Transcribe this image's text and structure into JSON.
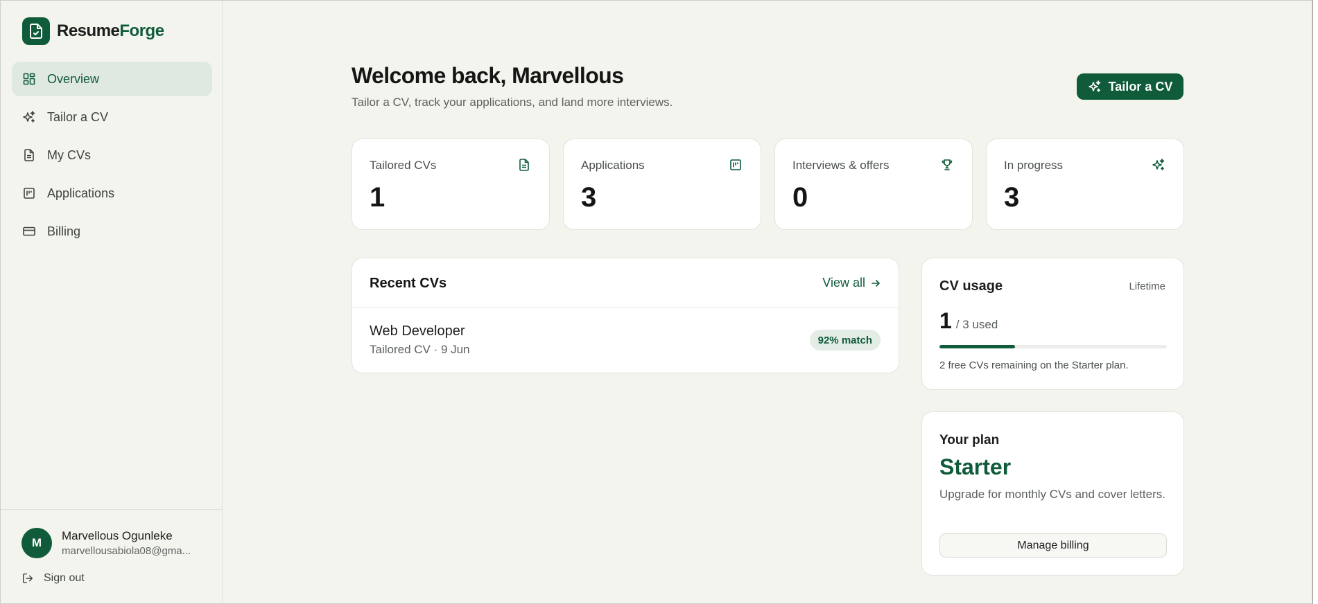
{
  "brand": {
    "part1": "Resume",
    "part2": "Forge",
    "logo_icon": "document-check-icon"
  },
  "colors": {
    "accent": "#0f5b3a",
    "active_bg": "#dfe8e1",
    "page_bg": "#f4f4ef",
    "card_bg": "#ffffff"
  },
  "sidebar": {
    "items": [
      {
        "label": "Overview",
        "icon": "dashboard-icon",
        "active": true
      },
      {
        "label": "Tailor a CV",
        "icon": "sparkles-icon",
        "active": false
      },
      {
        "label": "My CVs",
        "icon": "document-icon",
        "active": false
      },
      {
        "label": "Applications",
        "icon": "kanban-icon",
        "active": false
      },
      {
        "label": "Billing",
        "icon": "credit-card-icon",
        "active": false
      }
    ]
  },
  "user": {
    "initial": "M",
    "name": "Marvellous Ogunleke",
    "email": "marvellousabiola08@gma..."
  },
  "signout": {
    "label": "Sign out",
    "icon": "logout-icon"
  },
  "header": {
    "title": "Welcome back, Marvellous",
    "subtitle": "Tailor a CV, track your applications, and land more interviews.",
    "primary_button": "Tailor a CV"
  },
  "stats": [
    {
      "label": "Tailored CVs",
      "value": "1",
      "icon": "document-icon"
    },
    {
      "label": "Applications",
      "value": "3",
      "icon": "kanban-icon"
    },
    {
      "label": "Interviews & offers",
      "value": "0",
      "icon": "trophy-icon"
    },
    {
      "label": "In progress",
      "value": "3",
      "icon": "sparkles-icon"
    }
  ],
  "recent": {
    "title": "Recent CVs",
    "view_all": "View all",
    "items": [
      {
        "name": "Web Developer",
        "meta": "Tailored CV · 9 Jun",
        "badge": "92% match"
      }
    ]
  },
  "usage": {
    "title": "CV usage",
    "period": "Lifetime",
    "used": "1",
    "total_text": "/ 3 used",
    "fraction": 0.3333,
    "note": "2 free CVs remaining on the Starter plan."
  },
  "plan": {
    "label": "Your plan",
    "name": "Starter",
    "description": "Upgrade for monthly CVs and cover letters.",
    "button": "Manage billing"
  }
}
